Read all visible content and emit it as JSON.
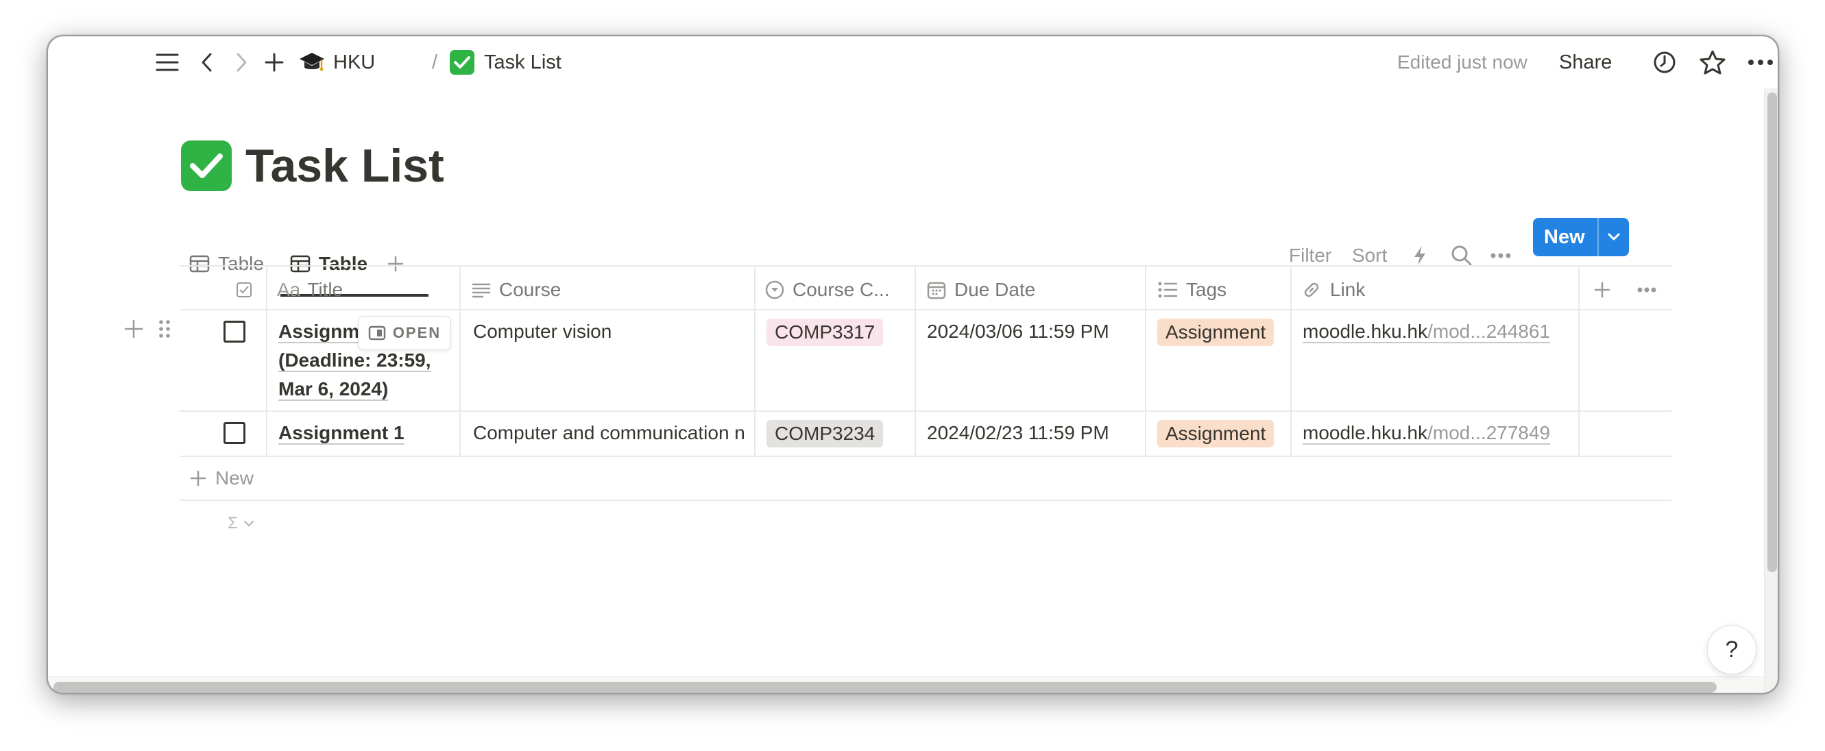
{
  "topbar": {
    "breadcrumb": [
      {
        "label": "HKU",
        "icon": "graduation-cap-icon"
      },
      {
        "label": "Task List",
        "icon": "green-check-icon"
      }
    ],
    "separator": "/",
    "edited_status": "Edited just now",
    "share_label": "Share"
  },
  "page": {
    "title": "Task List",
    "title_icon": "green-check-icon"
  },
  "views": {
    "tabs": [
      {
        "label": "Table",
        "active": false
      },
      {
        "label": "Table",
        "active": true
      }
    ],
    "toolbar": {
      "filter_label": "Filter",
      "sort_label": "Sort",
      "new_label": "New"
    }
  },
  "table": {
    "columns": [
      {
        "label": "Title",
        "prefix": "Aa",
        "icon": "text-icon"
      },
      {
        "label": "Course",
        "icon": "lines-icon"
      },
      {
        "label": "Course C...",
        "icon": "select-icon"
      },
      {
        "label": "Due Date",
        "icon": "calendar-icon"
      },
      {
        "label": "Tags",
        "icon": "list-icon"
      },
      {
        "label": "Link",
        "icon": "link-icon"
      }
    ],
    "rows": [
      {
        "title_line1": "Assignm",
        "title_line2": "(Deadline: 23:59,",
        "title_line3": "Mar 6, 2024)",
        "course": "Computer vision",
        "course_code": "COMP3317",
        "due_date": "2024/03/06 11:59 PM",
        "tag": "Assignment",
        "link_host": "moodle.hku.hk",
        "link_path": "/mod...244861"
      },
      {
        "title_line1": "Assignment 1",
        "course": "Computer and communication n",
        "course_code": "COMP3234",
        "due_date": "2024/02/23 11:59 PM",
        "tag": "Assignment",
        "link_host": "moodle.hku.hk",
        "link_path": "/mod...277849"
      }
    ],
    "open_label": "OPEN",
    "new_row_label": "New",
    "calc_label": "Σ"
  },
  "help_label": "?",
  "colors": {
    "accent": "#2383e2",
    "tag_pink": "#f9e4ec",
    "tag_gray": "#e3e2e0",
    "tag_orange": "#fadec9",
    "check_green": "#2fb344"
  }
}
